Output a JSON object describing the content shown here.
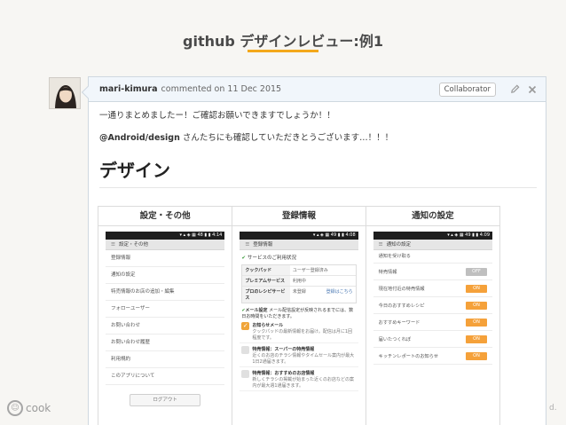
{
  "slide": {
    "title": "github デザインレビュー:例1",
    "footer_logo_text": "cook",
    "footer_right_text": "d."
  },
  "colors": {
    "accent": "#f3a81b",
    "header_bg": "#f1f6fb",
    "toggle_on": "#f5a13a",
    "toggle_off": "#bfbfbf"
  },
  "comment": {
    "author": "mari-kimura",
    "meta": "commented on 11 Dec 2015",
    "badge": "Collaborator",
    "edit_icon": "pencil-icon",
    "close_icon": "close-icon",
    "line1": "一通りまとめましたー！ご確認お願いできますでしょうか！！",
    "mention": "@Android/design",
    "line2_rest": " さんたちにも確認していただきとうございます…！！！",
    "heading": "デザイン"
  },
  "columns": [
    {
      "title": "設定・その他"
    },
    {
      "title": "登録情報"
    },
    {
      "title": "通知の設定"
    }
  ],
  "screen1": {
    "status": "▾ ▴ ◈ ▦ 48 ▮ ▮ 4:14",
    "appbar": "設定・その他",
    "items": [
      "登録情報",
      "通知の設定",
      "特売情報のお店の追加・編集",
      "フォローユーザー",
      "お問い合わせ",
      "お問い合わせ履歴",
      "利用規約",
      "このアプリについて"
    ],
    "logout": "ログアウト"
  },
  "screen2": {
    "status": "▾ ▴ ◈ ▦ 49 ▮ ▮ 4:08",
    "appbar": "登録情報",
    "section": "サービスのご利用状況",
    "rows": [
      {
        "k": "クックパッド",
        "v": "ユーザー登録済み",
        "link": ""
      },
      {
        "k": "プレミアムサービス",
        "v": "利用中",
        "link": ""
      },
      {
        "k": "プロのレシピサービス",
        "v": "未登録",
        "link": "登録はこちら"
      }
    ],
    "mail_title": "メール設定",
    "mail_note": "メール配信設定が反映されるまでには、数日お時間をいただきます。",
    "options": [
      {
        "title": "お知らせメール",
        "desc": "クックパッドの最新情報をお届け。配信は月に1回程度です。",
        "checked": true
      },
      {
        "title": "特売情報：スーパーの特売情報",
        "desc": "近くのお店のチラシ情報やタイムセール案内が最大1日2通届きます。",
        "checked": false
      },
      {
        "title": "特売情報：おすすめのお店情報",
        "desc": "新しくチラシの掲載が始まった近くのお店などの案内が最大週1通届きます。",
        "checked": false
      }
    ]
  },
  "screen3": {
    "status": "▾ ▴ ◈ ▦ 49 ▮ ▮ 4:09",
    "appbar": "通知の設定",
    "subheader": "通知を受け取る",
    "rows": [
      {
        "label": "特売情報",
        "state": "OFF"
      },
      {
        "label": "現在地付近の特売情報",
        "state": "ON"
      },
      {
        "label": "今日のおすすめレシピ",
        "state": "ON"
      },
      {
        "label": "おすすめキーワード",
        "state": "ON"
      },
      {
        "label": "届いたつくれぽ",
        "state": "ON"
      },
      {
        "label": "キッチンレポートのお知らせ",
        "state": "ON"
      }
    ]
  }
}
